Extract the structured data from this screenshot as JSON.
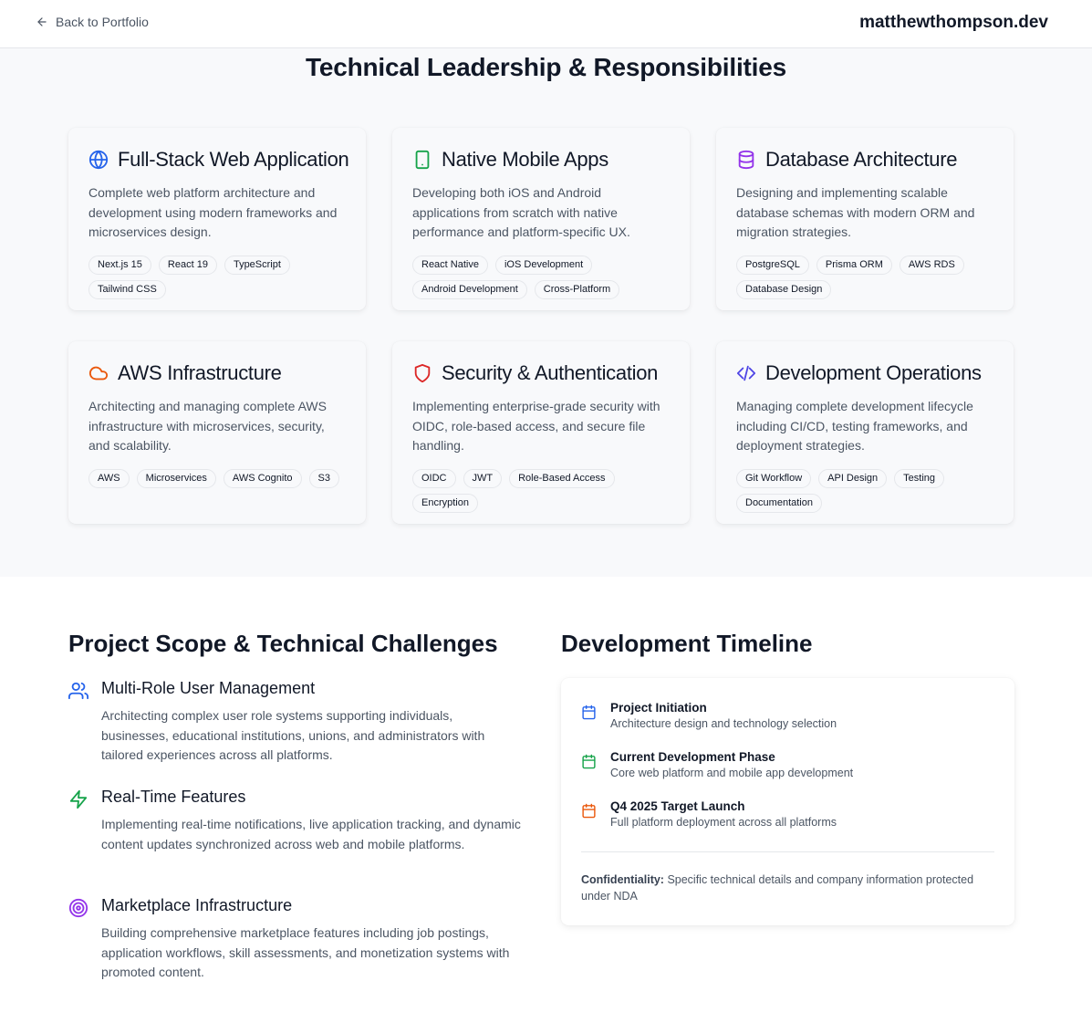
{
  "header": {
    "back_label": "Back to Portfolio",
    "site_name": "matthewthompson.dev"
  },
  "leadership": {
    "title": "Technical Leadership & Responsibilities",
    "cards": [
      {
        "icon": "globe-icon",
        "title": "Full-Stack Web Application",
        "description": "Complete web platform architecture and development using modern frameworks and microservices design.",
        "tags": [
          "Next.js 15",
          "React 19",
          "TypeScript",
          "Tailwind CSS"
        ],
        "color": "#2563eb"
      },
      {
        "icon": "smartphone-icon",
        "title": "Native Mobile Apps",
        "description": "Developing both iOS and Android applications from scratch with native performance and platform-specific UX.",
        "tags": [
          "React Native",
          "iOS Development",
          "Android Development",
          "Cross-Platform"
        ],
        "color": "#16a34a"
      },
      {
        "icon": "database-icon",
        "title": "Database Architecture",
        "description": "Designing and implementing scalable database schemas with modern ORM and migration strategies.",
        "tags": [
          "PostgreSQL",
          "Prisma ORM",
          "AWS RDS",
          "Database Design"
        ],
        "color": "#9333ea"
      },
      {
        "icon": "cloud-icon",
        "title": "AWS Infrastructure",
        "description": "Architecting and managing complete AWS infrastructure with microservices, security, and scalability.",
        "tags": [
          "AWS",
          "Microservices",
          "AWS Cognito",
          "S3"
        ],
        "color": "#ea580c"
      },
      {
        "icon": "shield-icon",
        "title": "Security & Authentication",
        "description": "Implementing enterprise-grade security with OIDC, role-based access, and secure file handling.",
        "tags": [
          "OIDC",
          "JWT",
          "Role-Based Access",
          "Encryption"
        ],
        "color": "#dc2626"
      },
      {
        "icon": "code-icon",
        "title": "Development Operations",
        "description": "Managing complete development lifecycle including CI/CD, testing frameworks, and deployment strategies.",
        "tags": [
          "Git Workflow",
          "API Design",
          "Testing",
          "Documentation"
        ],
        "color": "#4f46e5"
      }
    ]
  },
  "scope": {
    "title": "Project Scope & Technical Challenges",
    "items": [
      {
        "icon": "users-icon",
        "title": "Multi-Role User Management",
        "description": "Architecting complex user role systems supporting individuals, businesses, educational institutions, unions, and administrators with tailored experiences across all platforms.",
        "color": "#2563eb"
      },
      {
        "icon": "zap-icon",
        "title": "Real-Time Features",
        "description": "Implementing real-time notifications, live application tracking, and dynamic content updates synchronized across web and mobile platforms.",
        "color": "#16a34a"
      },
      {
        "icon": "target-icon",
        "title": "Marketplace Infrastructure",
        "description": "Building comprehensive marketplace features including job postings, application workflows, skill assessments, and monetization systems with promoted content.",
        "color": "#9333ea"
      }
    ]
  },
  "timeline": {
    "title": "Development Timeline",
    "items": [
      {
        "icon": "calendar-icon",
        "title": "Project Initiation",
        "description": "Architecture design and technology selection",
        "color": "#2563eb"
      },
      {
        "icon": "calendar-icon",
        "title": "Current Development Phase",
        "description": "Core web platform and mobile app development",
        "color": "#16a34a"
      },
      {
        "icon": "calendar-icon",
        "title": "Q4 2025 Target Launch",
        "description": "Full platform deployment across all platforms",
        "color": "#ea580c"
      }
    ],
    "note_label": "Confidentiality:",
    "note_text": " Specific technical details and company information protected under NDA"
  }
}
